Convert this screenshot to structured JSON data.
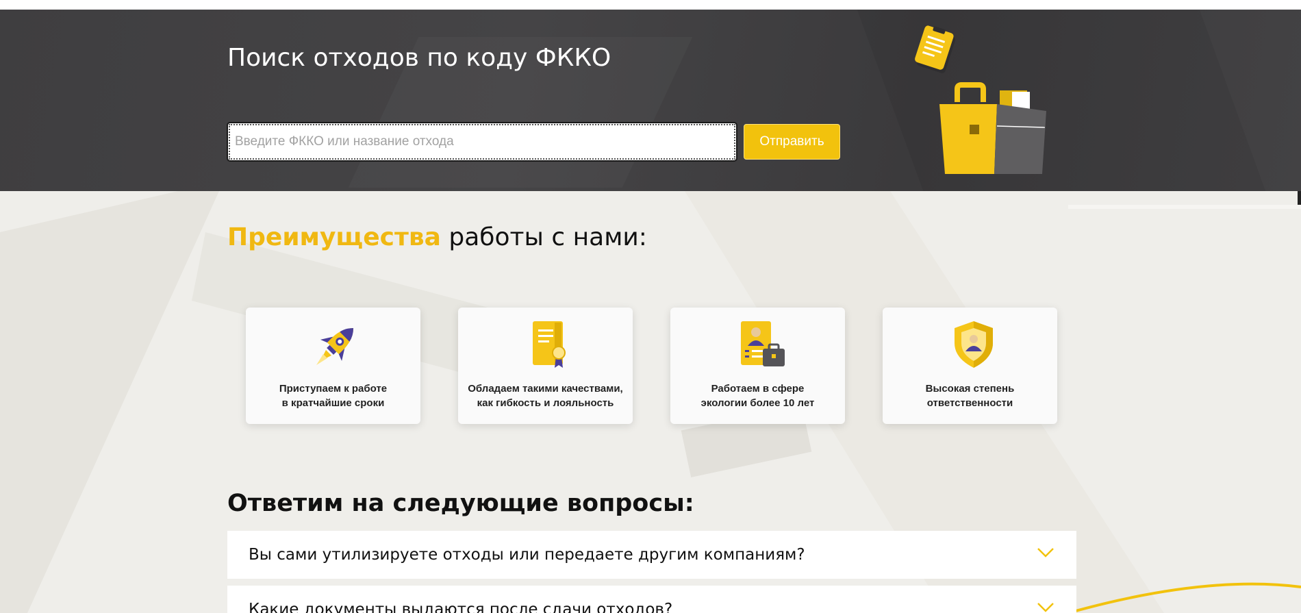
{
  "search": {
    "title": "Поиск отходов по коду ФККО",
    "placeholder": "Введите ФККО или название отхода",
    "submit_label": "Отправить",
    "art_icon": "briefcase-document-icon"
  },
  "advantages": {
    "heading_accent": "Преимущества",
    "heading_rest": " работы с нами:",
    "cards": [
      {
        "icon": "rocket-icon",
        "line1": "Приступаем к работе",
        "line2": "в кратчайшие сроки"
      },
      {
        "icon": "certificate-icon",
        "line1": "Обладаем такими качествами,",
        "line2": "как гибкость и лояльность"
      },
      {
        "icon": "resume-briefcase-icon",
        "line1": "Работаем в сфере",
        "line2": "экологии более 10 лет"
      },
      {
        "icon": "shield-person-icon",
        "line1": "Высокая степень",
        "line2": "ответственности"
      }
    ]
  },
  "faq": {
    "heading": "Ответим на следующие вопросы:",
    "items": [
      {
        "question": "Вы сами утилизируете отходы или передаете другим компаниям?"
      },
      {
        "question": "Какие документы выдаются после сдачи отходов?"
      }
    ]
  },
  "colors": {
    "accent": "#f2c20d",
    "dark_band": "#434244",
    "icon_purple": "#4a3f9a"
  }
}
